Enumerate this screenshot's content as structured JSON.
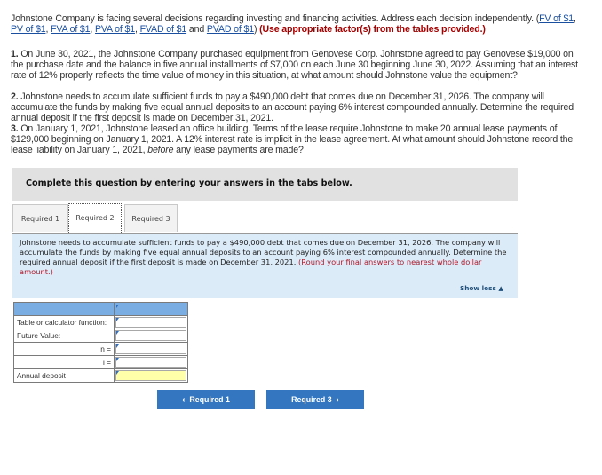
{
  "intro": {
    "text": "Johnstone Company is facing several decisions regarding investing and financing activities. Address each decision independently. (",
    "links": [
      "FV of $1",
      "PV of $1",
      "FVA of $1",
      "PVA of $1",
      "FVAD of $1",
      "PVAD of $1"
    ],
    "and": "and",
    "instruction": "(Use appropriate factor(s) from the tables provided.)"
  },
  "questions": [
    {
      "num": "1.",
      "text": "On June 30, 2021, the Johnstone Company purchased equipment from Genovese Corp. Johnstone agreed to pay Genovese $19,000 on the purchase date and the balance in five annual installments of $7,000 on each June 30 beginning June 30, 2022. Assuming that an interest rate of 12% properly reflects the time value of money in this situation, at what amount should Johnstone value the equipment?"
    },
    {
      "num": "2.",
      "text": "Johnstone needs to accumulate sufficient funds to pay a $490,000 debt that comes due on December 31, 2026. The company will accumulate the funds by making five equal annual deposits to an account paying 6% interest compounded annually. Determine the required annual deposit if the first deposit is made on December 31, 2021."
    },
    {
      "num": "3.",
      "text_before": "On January 1, 2021, Johnstone leased an office building. Terms of the lease require Johnstone to make 20 annual lease payments of $129,000 beginning on January 1, 2021. A 12% interest rate is implicit in the lease agreement. At what amount should Johnstone record the lease liability on January 1, 2021,",
      "text_italic": "before",
      "text_after": "any lease payments are made?"
    }
  ],
  "panel": {
    "heading": "Complete this question by entering your answers in the tabs below."
  },
  "tabs": [
    {
      "label": "Required 1",
      "active": false
    },
    {
      "label": "Required 2",
      "active": true
    },
    {
      "label": "Required 3",
      "active": false
    }
  ],
  "content": {
    "text": "Johnstone needs to accumulate sufficient funds to pay a $490,000 debt that comes due on December 31, 2026. The company will accumulate the funds by making five equal annual deposits to an account paying 6% interest compounded annually. Determine the required annual deposit if the first deposit is made on December 31, 2021.",
    "note": "(Round your final answers to nearest whole dollar amount.)",
    "show_less": "Show less",
    "show_less_icon": "▲"
  },
  "table": {
    "rows": [
      {
        "label": "Table or calculator function:",
        "align": "left",
        "value": ""
      },
      {
        "label": "Future Value:",
        "align": "left",
        "value": ""
      },
      {
        "label": "n =",
        "align": "right",
        "value": ""
      },
      {
        "label": "i =",
        "align": "right",
        "value": ""
      },
      {
        "label": "Annual deposit",
        "align": "left",
        "value": ""
      }
    ]
  },
  "nav": {
    "prev_label": "Required 1",
    "prev_icon": "‹",
    "next_label": "Required 3",
    "next_icon": "›"
  },
  "colors": {
    "accent_blue": "#3477c0",
    "table_header": "#7aaee3",
    "content_bg": "#dcebf8",
    "answer_highlight": "#ffffaa",
    "instruction_red": "#a30000"
  }
}
